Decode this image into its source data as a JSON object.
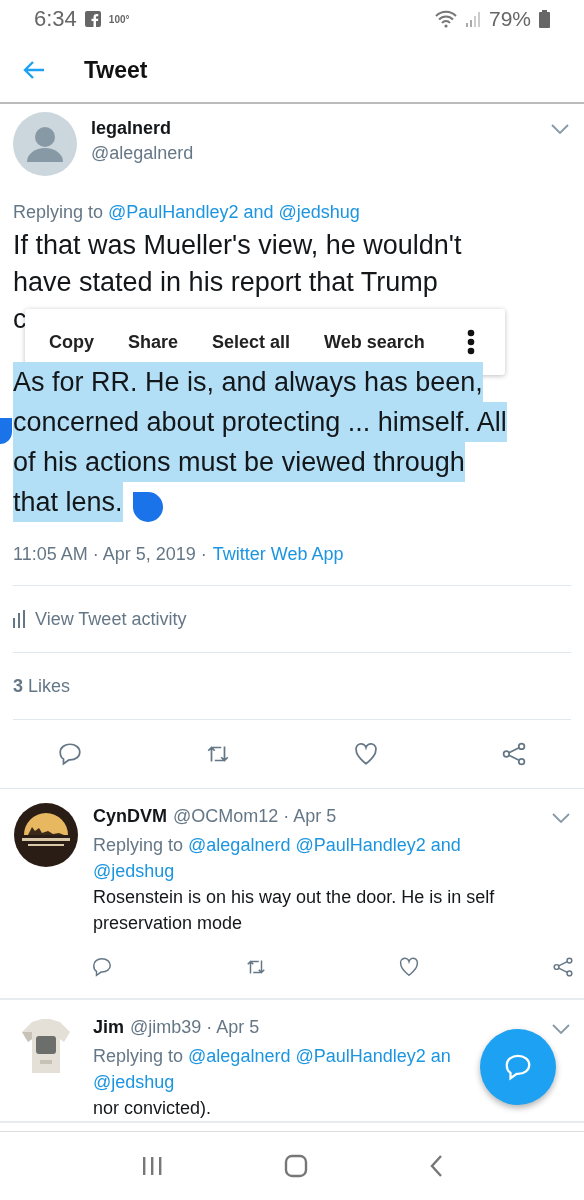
{
  "status_bar": {
    "time": "6:34",
    "temperature": "100°",
    "battery": "79%"
  },
  "header": {
    "title": "Tweet"
  },
  "tweet": {
    "name": "legalnerd",
    "handle": "@alegalnerd",
    "replying_prefix": "Replying to",
    "replying_lines": [
      "@PaulHandley2 and @jedshug"
    ],
    "text_lines": [
      "If that was Mueller's view, he wouldn't",
      "have stated in his report that Trump",
      "c"
    ],
    "selected_lines": [
      "As for RR. He is, and always has been,",
      "concerned about protecting ... himself. All",
      "of his actions must be viewed through",
      "that lens."
    ],
    "meta": "11:05 AM · Apr 5, 2019 ·",
    "source": "Twitter Web App",
    "activity": "View Tweet activity",
    "likes": "**3** Likes"
  },
  "context_menu": {
    "items": [
      "Copy",
      "Share",
      "Select all",
      "Web search"
    ]
  },
  "replies": [
    {
      "name": "CynDVM",
      "handle": "@OCMom12 · Apr 5",
      "replying_prefix": "Replying to",
      "replying_lines": [
        "@alegalnerd @PaulHandley2 and",
        "@jedshug"
      ],
      "text_lines": [
        "Rosenstein is on his way out the door. He is in self",
        "preservation mode"
      ]
    },
    {
      "name": "Jim",
      "handle": "@jimb39 · Apr 5",
      "replying_prefix": "Replying to",
      "replying_lines": [
        "@alegalnerd @PaulHandley2 an",
        "@jedshug"
      ],
      "text_lines": [
        "nor convicted)."
      ]
    }
  ]
}
